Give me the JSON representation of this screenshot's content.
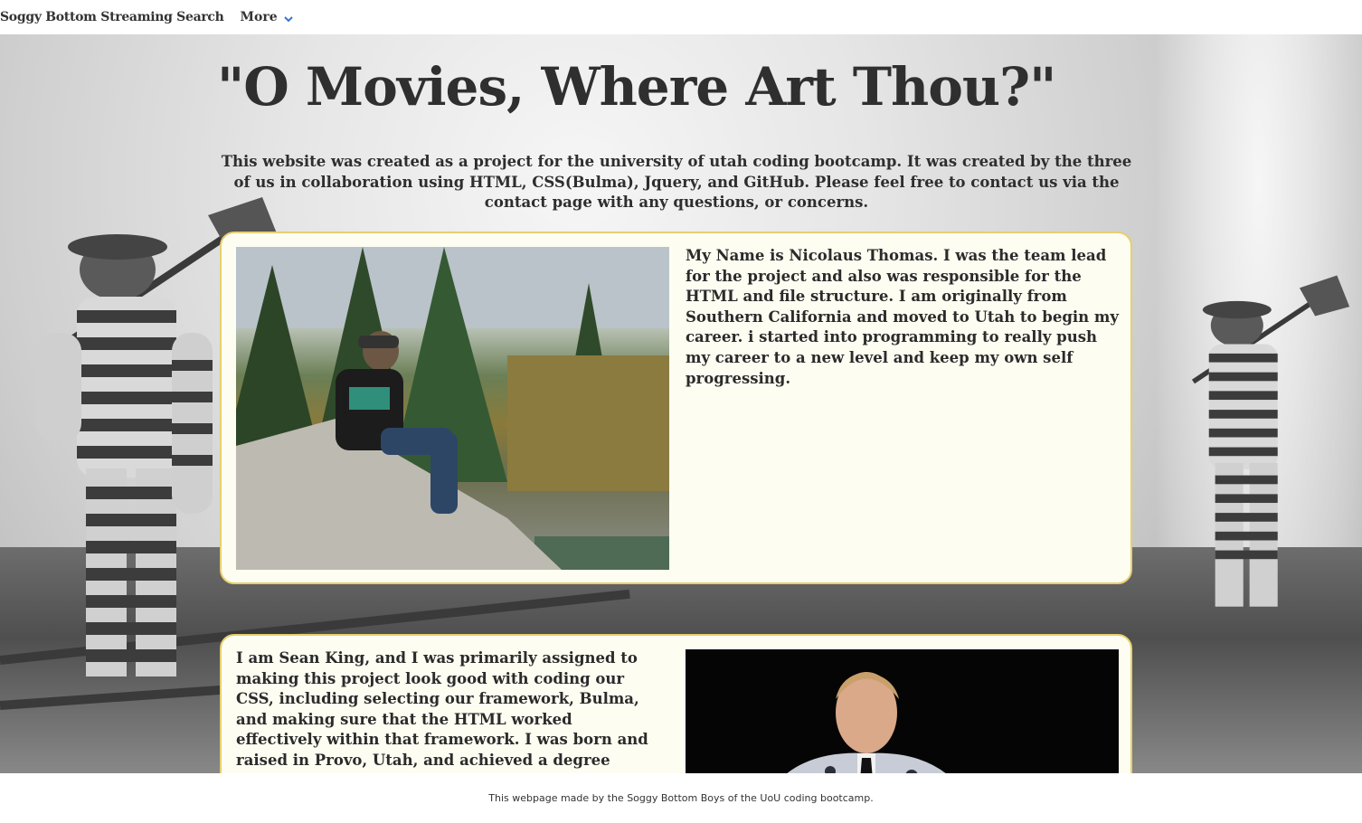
{
  "navbar": {
    "brand": "Soggy Bottom Streaming Search",
    "more_label": "More"
  },
  "hero": {
    "title": "\"O Movies, Where Art Thou?\"",
    "intro": "This website was created as a project for the university of utah coding bootcamp. It was created by the three of us in collaboration using HTML, CSS(Bulma), Jquery, and GitHub. Please feel free to contact us via the contact page with any questions, or concerns."
  },
  "team": [
    {
      "bio": "My Name is Nicolaus Thomas. I was the team lead for the project and also was responsible for the HTML and file structure. I am originally from Southern California and moved to Utah to begin my career. i started into programming to really push my career to a new level and keep my own self progressing.",
      "photo": "person-sitting-on-rock-photo"
    },
    {
      "bio": "I am Sean King, and I was primarily assigned to making this project look good with coding our CSS, including selecting our framework, Bulma, and making sure that the HTML worked effectively within that framework. I was born and raised in Provo, Utah, and achieved a degree from the",
      "photo": "portrait-in-patterned-suit-photo"
    }
  ],
  "footer": {
    "text": "This webpage made by the Soggy Bottom Boys of the UoU coding bootcamp."
  },
  "colors": {
    "card_border": "#e7cf6e",
    "card_bg": "#fdfdf2",
    "chevron": "#3273dc"
  }
}
